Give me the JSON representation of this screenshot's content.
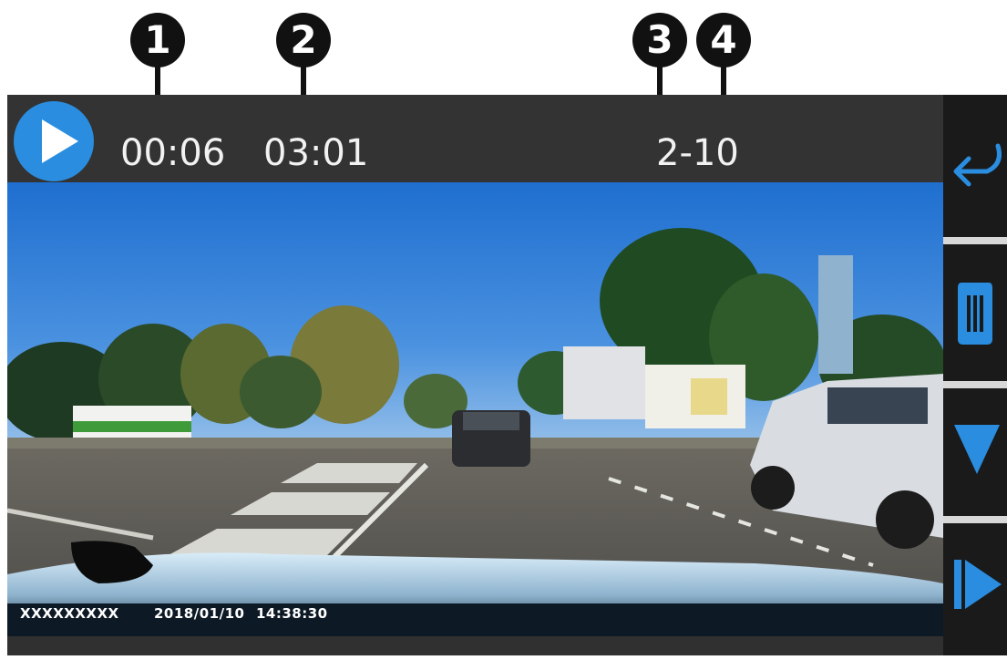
{
  "callouts": [
    "1",
    "2",
    "3",
    "4"
  ],
  "player": {
    "elapsed_time": "00:06",
    "total_time": "03:01",
    "file_index": "2-10"
  },
  "overlay": {
    "device_id": "XXXXXXXXX",
    "date": "2018/01/10",
    "time": "14:38:30"
  },
  "icons": {
    "play": "play-icon",
    "back": "back-arrow-icon",
    "delete": "trash-icon",
    "next": "triangle-down-icon",
    "fast_forward": "fast-forward-icon"
  },
  "colors": {
    "accent": "#2a8de0",
    "topbar": "#333333",
    "sidebar": "#1a1a1a",
    "separator": "#d8d8d8"
  }
}
